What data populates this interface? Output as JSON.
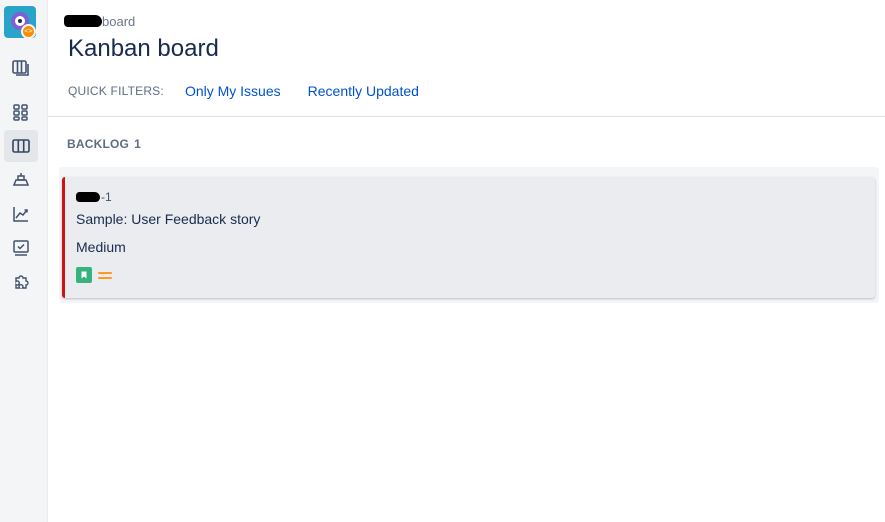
{
  "header": {
    "breadcrumb_suffix": "board",
    "title": "Kanban board"
  },
  "quick_filters": {
    "label": "QUICK FILTERS:",
    "items": [
      {
        "label": "Only My Issues"
      },
      {
        "label": "Recently Updated"
      }
    ]
  },
  "columns": [
    {
      "name": "BACKLOG",
      "count": "1",
      "cards": [
        {
          "key_suffix": "-1",
          "summary": "Sample: User Feedback story",
          "priority_label": "Medium",
          "issue_type_icon": "story-icon",
          "priority_icon": "priority-medium-icon"
        }
      ]
    }
  ],
  "colors": {
    "link": "#0052cc",
    "card_border": "#cd1317",
    "story": "#36b37e",
    "priority_medium": "#ff991f"
  },
  "nav_icons": [
    "project-avatar",
    "board-icon",
    "roadmap-icon",
    "kanban-board-icon",
    "releases-icon",
    "reports-icon",
    "issues-icon",
    "add-ons-icon"
  ]
}
